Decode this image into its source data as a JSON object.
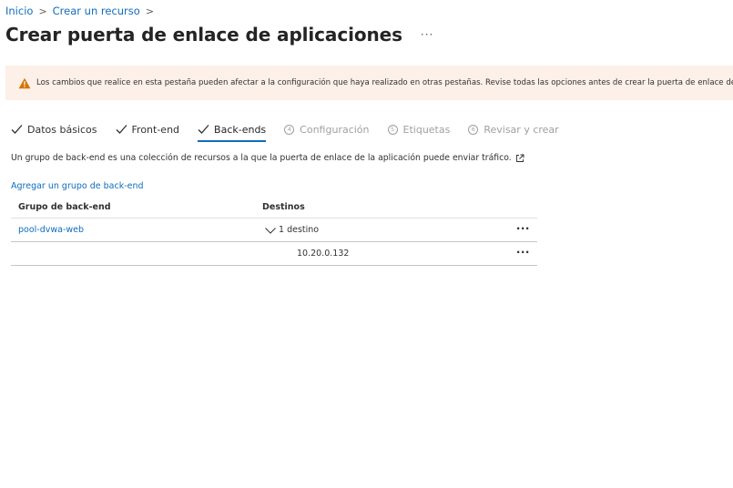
{
  "breadcrumb": {
    "items": [
      "Inicio",
      "Crear un recurso"
    ],
    "separator": ">"
  },
  "page": {
    "title": "Crear puerta de enlace de aplicaciones",
    "more": "···"
  },
  "warning": {
    "text": "Los cambios que realice en esta pestaña pueden afectar a la configuración que haya realizado en otras pestañas. Revise todas las opciones antes de crear la puerta de enlace de aplic",
    "icon": "warning-icon",
    "background": "#fdf0e8",
    "icon_color": "#d47500"
  },
  "tabs": [
    {
      "label": "Datos básicos",
      "state": "done"
    },
    {
      "label": "Front-end",
      "state": "done"
    },
    {
      "label": "Back-ends",
      "state": "active"
    },
    {
      "label": "Configuración",
      "state": "pending",
      "number": "4"
    },
    {
      "label": "Etiquetas",
      "state": "pending",
      "number": "5"
    },
    {
      "label": "Revisar y crear",
      "state": "pending",
      "number": "6"
    }
  ],
  "description": "Un grupo de back-end es una colección de recursos a la que la puerta de enlace de la aplicación puede enviar tráfico.",
  "add_link": "Agregar un grupo de back-end",
  "table": {
    "headers": [
      "Grupo de back-end",
      "Destinos"
    ],
    "rows": [
      {
        "group": "pool-dvwa-web",
        "targets": "1 destino",
        "more": "···"
      },
      {
        "group": "",
        "targets": "10.20.0.132",
        "more": "···"
      }
    ]
  },
  "colors": {
    "link": "#0f6cbd",
    "text": "#323130",
    "disabled": "#a19f9d"
  }
}
